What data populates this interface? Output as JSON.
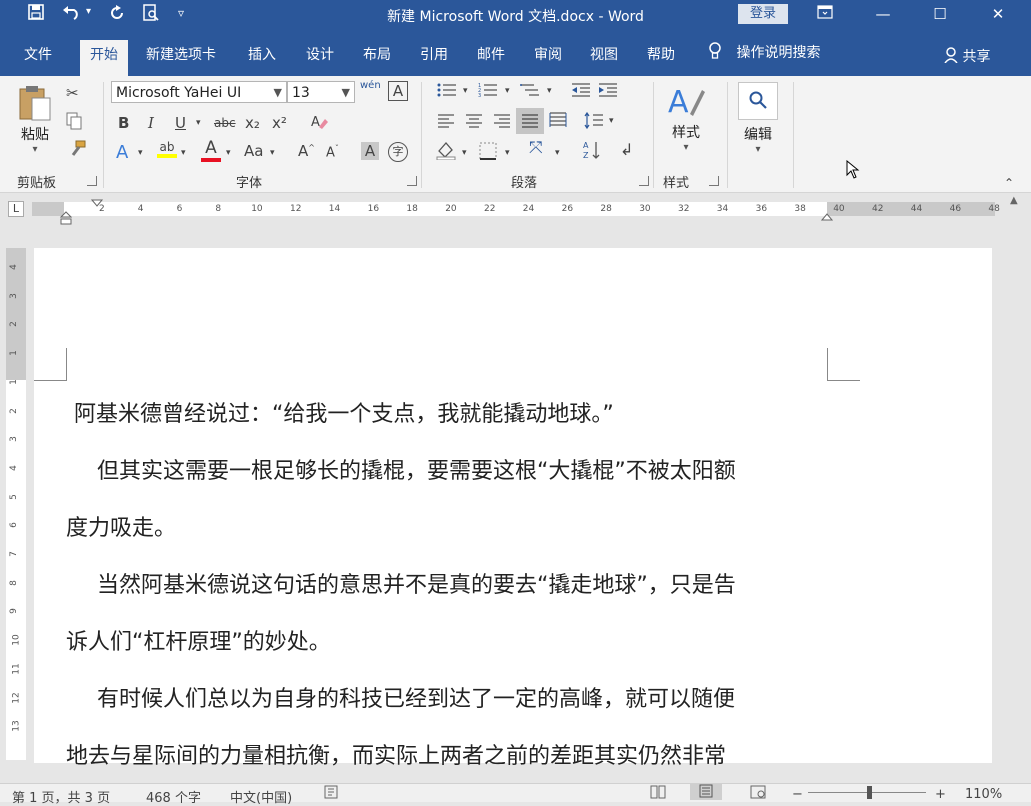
{
  "titlebar": {
    "title": "新建 Microsoft Word 文档.docx  -  Word",
    "login": "登录",
    "save_icon": "save-icon",
    "undo_icon": "undo-icon",
    "redo_icon": "repeat-icon",
    "preview_icon": "print-preview-icon",
    "customize_icon": "customize-qat-icon"
  },
  "tabs": {
    "file": "文件",
    "home": "开始",
    "new_tab": "新建选项卡",
    "insert": "插入",
    "design": "设计",
    "layout": "布局",
    "references": "引用",
    "mailings": "邮件",
    "review": "审阅",
    "view": "视图",
    "help": "帮助",
    "tell_me": "操作说明搜索",
    "share": "共享"
  },
  "ribbon": {
    "clipboard": {
      "paste": "粘贴",
      "label": "剪贴板"
    },
    "font": {
      "name": "Microsoft YaHei UI",
      "size": "13",
      "label": "字体",
      "phonetic": "wén",
      "bold": "B",
      "italic": "I",
      "underline": "U",
      "strike": "abc",
      "subscript": "x₂",
      "superscript": "x²",
      "effects": "A",
      "highlight": "ab",
      "font_color": "A",
      "change_case": "Aa",
      "grow": "A",
      "shrink": "A",
      "shading": "A",
      "enclose": "字"
    },
    "paragraph": {
      "label": "段落"
    },
    "styles": {
      "button": "样式",
      "label": "样式"
    },
    "editing": {
      "button": "编辑"
    }
  },
  "ruler": {
    "ticks": [
      "2",
      "4",
      "6",
      "8",
      "10",
      "12",
      "14",
      "16",
      "18",
      "20",
      "22",
      "24",
      "26",
      "28",
      "30",
      "32",
      "34",
      "36",
      "38",
      "40",
      "42",
      "44",
      "46",
      "48"
    ],
    "vticks": [
      "4",
      "3",
      "2",
      "1",
      "1",
      "2",
      "3",
      "4",
      "5",
      "6",
      "7",
      "8",
      "9",
      "10",
      "11",
      "12",
      "13"
    ]
  },
  "document": {
    "paragraphs": [
      "阿基米德曾经说过：“给我一个支点，我就能撬动地球。”",
      "但其实这需要一根足够长的撬棍，要需要这根“大撬棍”不被太阳额",
      "度力吸走。",
      "当然阿基米德说这句话的意思并不是真的要去“撬走地球”，只是告",
      "诉人们“杠杆原理”的妙处。",
      "有时候人们总以为自身的科技已经到达了一定的高峰，就可以随便",
      "地去与星际间的力量相抗衡，而实际上两者之前的差距其实仍然非常"
    ]
  },
  "statusbar": {
    "page": "第 1 页，共 3 页",
    "words": "468 个字",
    "language": "中文(中国)",
    "zoom": "110%"
  },
  "colors": {
    "brand": "#2b579a",
    "highlight": "#ffff00",
    "font_color": "#e81123"
  }
}
